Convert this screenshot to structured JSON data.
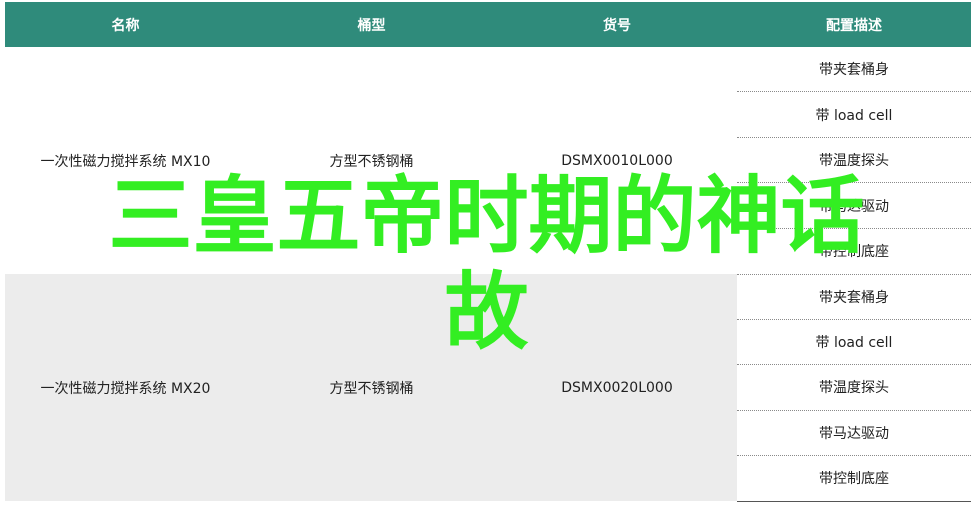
{
  "table": {
    "headers": [
      "名称",
      "桶型",
      "货号",
      "配置描述"
    ],
    "groups": [
      {
        "name": "一次性磁力搅拌系统 MX10",
        "type": "方型不锈钢桶",
        "code": "DSMX0010L000",
        "features": [
          "带夹套桶身",
          "带 load cell",
          "带温度探头",
          "带马达驱动",
          "带控制底座"
        ]
      },
      {
        "name": "一次性磁力搅拌系统 MX20",
        "type": "方型不锈钢桶",
        "code": "DSMX0020L000",
        "features": [
          "带夹套桶身",
          "带 load cell",
          "带温度探头",
          "带马达驱动",
          "带控制底座"
        ]
      }
    ]
  },
  "overlay": {
    "line1": "三皇五帝时期的神话",
    "line2": "故",
    "color": "#33ee22"
  },
  "colors": {
    "header_bg": "#2f8b7b",
    "alt_row_bg": "#ececec"
  }
}
